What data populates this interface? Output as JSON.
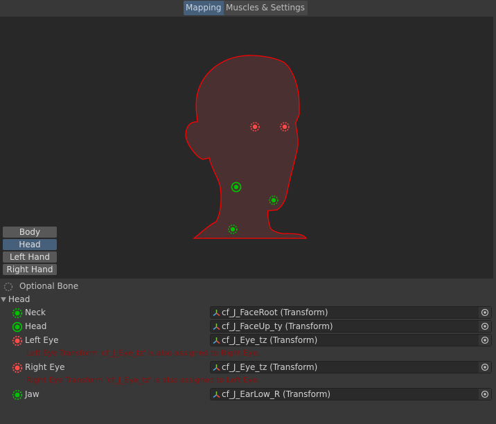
{
  "tabs": [
    {
      "label": "Mapping",
      "active": true
    },
    {
      "label": "Muscles & Settings",
      "active": false
    }
  ],
  "regions": [
    {
      "label": "Body"
    },
    {
      "label": "Head",
      "selected": true
    },
    {
      "label": "Left Hand"
    },
    {
      "label": "Right Hand"
    }
  ],
  "legend": {
    "optional_label": "Optional Bone"
  },
  "section": {
    "label": "Head",
    "expanded": true
  },
  "bones": [
    {
      "label": "Neck",
      "value": "cf_J_FaceRoot (Transform)",
      "status": "ok",
      "optional": true
    },
    {
      "label": "Head",
      "value": "cf_J_FaceUp_ty (Transform)",
      "status": "ok",
      "optional": false
    },
    {
      "label": "Left Eye",
      "value": "cf_J_Eye_tz (Transform)",
      "status": "error",
      "optional": true,
      "error": "Left Eye Transform 'cf_J_Eye_tz' is also assigned to Right Eye."
    },
    {
      "label": "Right Eye",
      "value": "cf_J_Eye_tz (Transform)",
      "status": "error",
      "optional": true,
      "error": "Right Eye Transform 'cf_J_Eye_tz' is also assigned to Left Eye."
    },
    {
      "label": "Jaw",
      "value": "cf_J_EarLow_R (Transform)",
      "status": "ok",
      "optional": true
    }
  ],
  "colors": {
    "ok": "#00c000",
    "error": "#ff4a4a",
    "silhouette_fill": "#4a3030",
    "silhouette_stroke": "#ff0000",
    "selected": "#46607c",
    "error_text": "#8b0d0d"
  }
}
